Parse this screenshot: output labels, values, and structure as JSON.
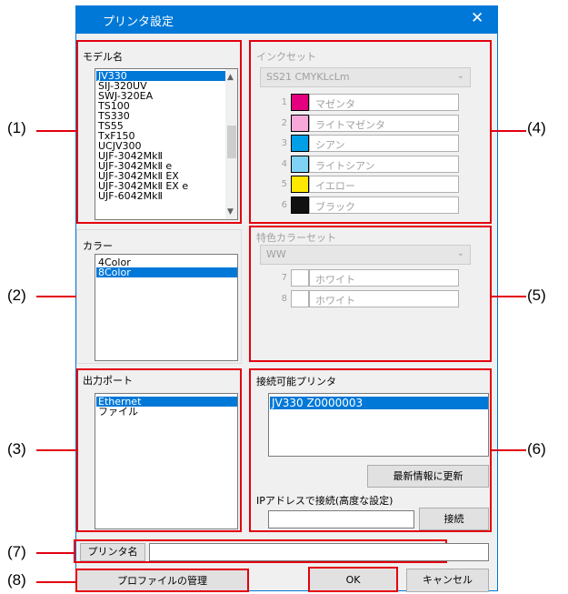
{
  "dialog": {
    "title": "プリンタ設定",
    "close_glyph": "✕"
  },
  "model": {
    "label": "モデル名",
    "items": [
      "JV330",
      "SIJ-320UV",
      "SWJ-320EA",
      "TS100",
      "TS330",
      "TS55",
      "TxF150",
      "UCJV300",
      "UJF-3042MkⅡ",
      "UJF-3042MkⅡ e",
      "UJF-3042MkⅡ EX",
      "UJF-3042MkⅡ EX e",
      "UJF-6042MkⅡ"
    ],
    "selected": "JV330"
  },
  "color": {
    "label": "カラー",
    "items": [
      "4Color",
      "8Color"
    ],
    "selected": "8Color"
  },
  "port": {
    "label": "出力ポート",
    "items": [
      "Ethernet",
      "ファイル"
    ],
    "selected": "Ethernet"
  },
  "inkset": {
    "label": "インクセット",
    "combo_value": "SS21 CMYKLcLm",
    "inks": [
      {
        "num": "1",
        "name": "マゼンタ",
        "color": "#e4007f"
      },
      {
        "num": "2",
        "name": "ライトマゼンタ",
        "color": "#f7a8d8"
      },
      {
        "num": "3",
        "name": "シアン",
        "color": "#00a0e9"
      },
      {
        "num": "4",
        "name": "ライトシアン",
        "color": "#7fd4f5"
      },
      {
        "num": "5",
        "name": "イエロー",
        "color": "#ffe800"
      },
      {
        "num": "6",
        "name": "ブラック",
        "color": "#111111"
      }
    ]
  },
  "special": {
    "label": "特色カラーセット",
    "combo_value": "WW",
    "inks": [
      {
        "num": "7",
        "name": "ホワイト",
        "color": "#ffffff"
      },
      {
        "num": "8",
        "name": "ホワイト",
        "color": "#ffffff"
      }
    ]
  },
  "printers": {
    "label": "接続可能プリンタ",
    "items": [
      "JV330 Z0000003"
    ],
    "selected": "JV330 Z0000003",
    "refresh_label": "最新情報に更新",
    "ip_label": "IPアドレスで接続(高度な設定)",
    "ip_value": "",
    "connect_label": "接続"
  },
  "printer_name": {
    "label": "プリンタ名",
    "value": ""
  },
  "buttons": {
    "profile": "プロファイルの管理",
    "ok": "OK",
    "cancel": "キャンセル"
  },
  "callouts": [
    "(1)",
    "(2)",
    "(3)",
    "(4)",
    "(5)",
    "(6)",
    "(7)",
    "(8)"
  ]
}
